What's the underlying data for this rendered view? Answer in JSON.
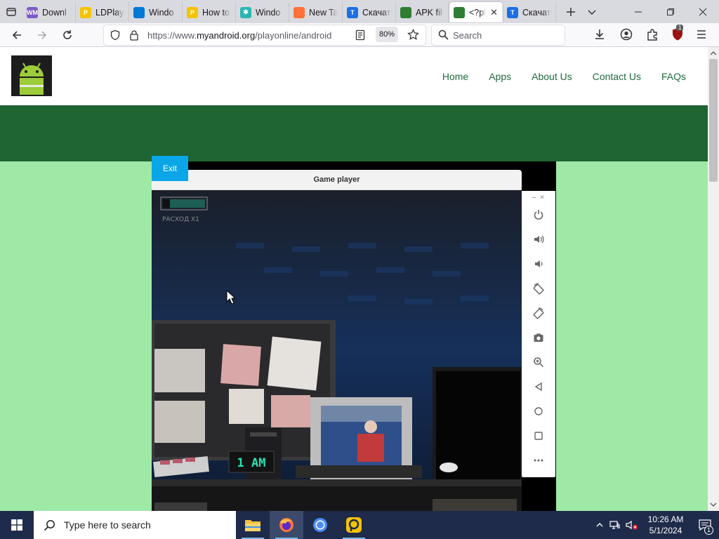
{
  "browser": {
    "tabs": [
      {
        "title": "Downl",
        "favicon_color": "#7c5cc4",
        "favicon_text": "WM"
      },
      {
        "title": "LDPlay",
        "favicon_color": "#f5c400",
        "favicon_text": "P"
      },
      {
        "title": "Windo",
        "favicon_color": "#0078d4",
        "favicon_text": ""
      },
      {
        "title": "How to",
        "favicon_color": "#f5c400",
        "favicon_text": "P"
      },
      {
        "title": "Windo",
        "favicon_color": "#2bb6b0",
        "favicon_text": "✱"
      },
      {
        "title": "New Ta",
        "favicon_color": "#ff7139",
        "favicon_text": ""
      },
      {
        "title": "Скачат",
        "favicon_color": "#1d6fe3",
        "favicon_text": "T"
      },
      {
        "title": "APK fil",
        "favicon_color": "#2e7d32",
        "favicon_text": ""
      },
      {
        "title": "<?pl",
        "favicon_color": "#2e7d32",
        "favicon_text": ""
      },
      {
        "title": "Скачат",
        "favicon_color": "#1d6fe3",
        "favicon_text": "T"
      }
    ],
    "active_tab_index": 8,
    "url_prefix": "https://www.",
    "url_domain": "myandroid.org",
    "url_path": "/playonline/android",
    "zoom": "80%",
    "search_placeholder": "Search",
    "extension_badge": "1"
  },
  "site": {
    "nav": [
      "Home",
      "Apps",
      "About Us",
      "Contact Us",
      "FAQs"
    ],
    "colors": {
      "link": "#1f6b3b",
      "band": "#1f6433",
      "content_bg": "#9ee9a6",
      "exit": "#0aa6e8"
    }
  },
  "player": {
    "exit_label": "Exit",
    "title": "Game player",
    "hud_text": "РАСХОД  X1",
    "clock_text": "1 AM",
    "side_buttons": [
      "power-icon",
      "volume-up-icon",
      "volume-down-icon",
      "rotate-left-icon",
      "rotate-right-icon",
      "camera-icon",
      "zoom-icon",
      "back-icon",
      "home-icon",
      "recents-icon",
      "more-icon"
    ]
  },
  "taskbar": {
    "search_placeholder": "Type here to search",
    "time": "10:26 AM",
    "date": "5/1/2024",
    "notification_count": "1"
  }
}
